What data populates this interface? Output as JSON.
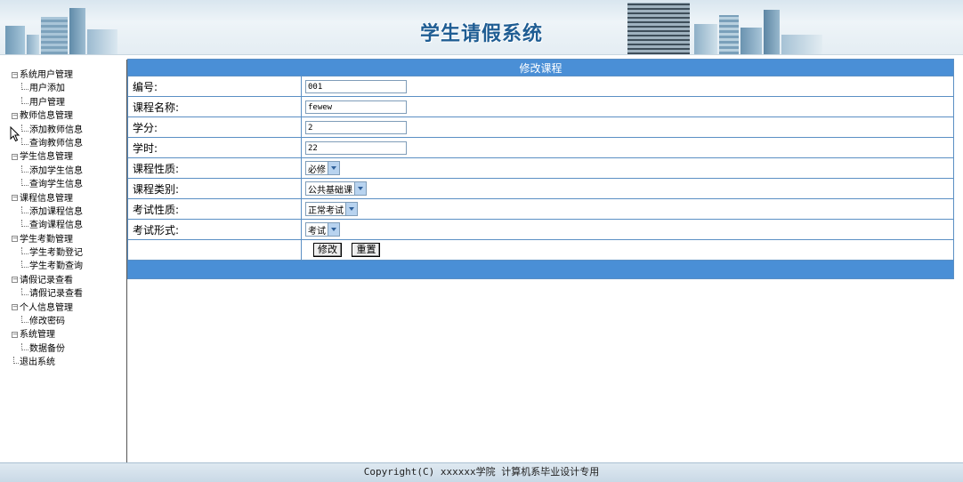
{
  "header": {
    "title": "学生请假系统"
  },
  "sidebar": {
    "items": [
      {
        "label": "系统用户管理",
        "type": "group"
      },
      {
        "label": "用户添加",
        "type": "leaf"
      },
      {
        "label": "用户管理",
        "type": "leaf"
      },
      {
        "label": "教师信息管理",
        "type": "group"
      },
      {
        "label": "添加教师信息",
        "type": "leaf"
      },
      {
        "label": "查询教师信息",
        "type": "leaf"
      },
      {
        "label": "学生信息管理",
        "type": "group"
      },
      {
        "label": "添加学生信息",
        "type": "leaf"
      },
      {
        "label": "查询学生信息",
        "type": "leaf"
      },
      {
        "label": "课程信息管理",
        "type": "group"
      },
      {
        "label": "添加课程信息",
        "type": "leaf"
      },
      {
        "label": "查询课程信息",
        "type": "leaf"
      },
      {
        "label": "学生考勤管理",
        "type": "group"
      },
      {
        "label": "学生考勤登记",
        "type": "leaf"
      },
      {
        "label": "学生考勤查询",
        "type": "leaf"
      },
      {
        "label": "请假记录查看",
        "type": "group"
      },
      {
        "label": "请假记录查看",
        "type": "leaf"
      },
      {
        "label": "个人信息管理",
        "type": "group"
      },
      {
        "label": "修改密码",
        "type": "leaf"
      },
      {
        "label": "系统管理",
        "type": "group"
      },
      {
        "label": "数据备份",
        "type": "leaf"
      },
      {
        "label": "退出系统",
        "type": "exit"
      }
    ]
  },
  "form": {
    "title": "修改课程",
    "fields": {
      "id": {
        "label": "编号:",
        "value": "001"
      },
      "name": {
        "label": "课程名称:",
        "value": "fewew"
      },
      "credit": {
        "label": "学分:",
        "value": "2"
      },
      "hours": {
        "label": "学时:",
        "value": "22"
      },
      "nature": {
        "label": "课程性质:",
        "value": "必修"
      },
      "category": {
        "label": "课程类别:",
        "value": "公共基础课"
      },
      "exam_nature": {
        "label": "考试性质:",
        "value": "正常考试"
      },
      "exam_form": {
        "label": "考试形式:",
        "value": "考试"
      }
    },
    "buttons": {
      "submit": "修改",
      "reset": "重置"
    }
  },
  "footer": {
    "copyright": "Copyright(C) xxxxxx学院 计算机系毕业设计专用"
  },
  "colors": {
    "accent": "#4a8fd6",
    "border": "#5b8fc4",
    "title": "#1f5d93"
  }
}
